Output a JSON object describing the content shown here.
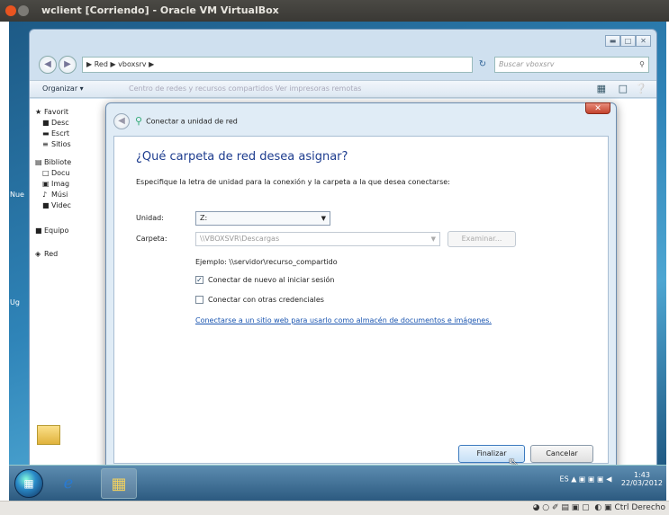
{
  "vbox": {
    "title": "wclient [Corriendo] - Oracle VM VirtualBox",
    "status_host_key": "Ctrl Derecho",
    "status_icons": "◕ ○ ✐ ▤ ▣ ▢  ◐ ▣"
  },
  "desktop": {
    "icon1": "Nue",
    "icon2": "Ug"
  },
  "explorer": {
    "address": "▶ Red ▶ vboxsrv ▶",
    "search_placeholder": "Buscar vboxsrv",
    "organize": "Organizar ▾",
    "organize_sub": "Centro de redes y recursos compartidos    Ver impresoras remotas",
    "nav": [
      {
        "icon": "★",
        "label": "Favorit"
      },
      {
        "icon": "■",
        "label": "Desc"
      },
      {
        "icon": "▬",
        "label": "Escrt"
      },
      {
        "icon": "≡",
        "label": "Sitios"
      },
      {
        "icon": "▤",
        "label": "Bibliote"
      },
      {
        "icon": "□",
        "label": "Docu"
      },
      {
        "icon": "▣",
        "label": "Imag"
      },
      {
        "icon": "♪",
        "label": "Músi"
      },
      {
        "icon": "■",
        "label": "Videc"
      },
      {
        "icon": "■",
        "label": "Equipo"
      },
      {
        "icon": "◈",
        "label": "Red"
      }
    ]
  },
  "dialog": {
    "title": "Conectar a unidad de red",
    "heading": "¿Qué carpeta de red desea asignar?",
    "instructions": "Especifique la letra de unidad para la conexión y la carpeta a la que desea conectarse:",
    "drive_label": "Unidad:",
    "drive_value": "Z:",
    "folder_label": "Carpeta:",
    "folder_value": "\\\\VBOXSVR\\Descargas",
    "browse": "Examinar...",
    "example": "Ejemplo: \\\\servidor\\recurso_compartido",
    "reconnect": "Conectar de nuevo al iniciar sesión",
    "reconnect_checked": true,
    "other_creds": "Conectar con otras credenciales",
    "other_creds_checked": false,
    "link": "Conectarse a un sitio web para usarlo como almacén de documentos e imágenes.",
    "finish": "Finalizar",
    "cancel": "Cancelar"
  },
  "taskbar": {
    "time": "1:43",
    "date": "22/03/2012",
    "tray_icons": "ES  ▲  ▣ ▣ ▣ ◀"
  }
}
